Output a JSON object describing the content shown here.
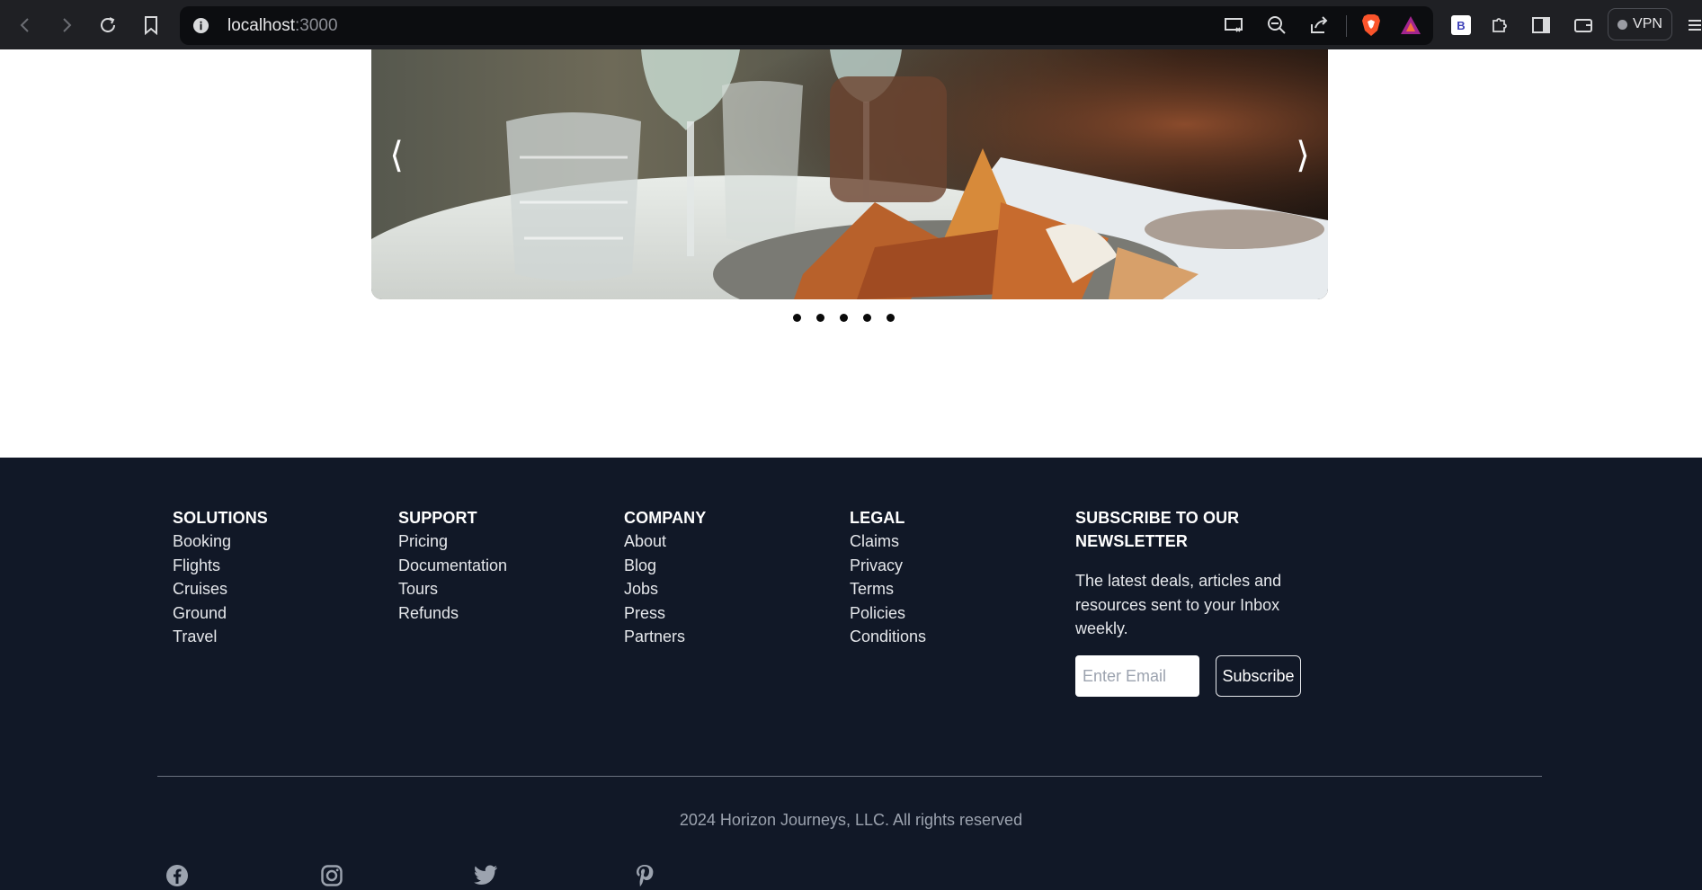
{
  "browser": {
    "url_host": "localhost",
    "url_port": ":3000",
    "vpn_label": "VPN",
    "bookmark_badge": "B"
  },
  "carousel": {
    "prev_glyph": "⟨",
    "next_glyph": "⟩",
    "slide_count": 5
  },
  "footer": {
    "columns": [
      {
        "title": "SOLUTIONS",
        "links": [
          "Booking",
          "Flights",
          "Cruises",
          "Ground",
          "Travel"
        ]
      },
      {
        "title": "SUPPORT",
        "links": [
          "Pricing",
          "Documentation",
          "Tours",
          "Refunds"
        ]
      },
      {
        "title": "COMPANY",
        "links": [
          "About",
          "Blog",
          "Jobs",
          "Press",
          "Partners"
        ]
      },
      {
        "title": "LEGAL",
        "links": [
          "Claims",
          "Privacy",
          "Terms",
          "Policies",
          "Conditions"
        ]
      }
    ],
    "newsletter": {
      "title": "SUBSCRIBE TO OUR NEWSLETTER",
      "description": "The latest deals, articles and resources sent to your Inbox weekly.",
      "email_placeholder": "Enter Email",
      "subscribe_label": "Subscribe"
    },
    "copyright": "2024 Horizon Journeys, LLC. All rights reserved",
    "social_icons": [
      "facebook-icon",
      "instagram-icon",
      "twitter-icon",
      "pinterest-icon"
    ]
  },
  "colors": {
    "chrome_bg": "#1f2024",
    "footer_bg": "#111827",
    "brave_orange": "#fb542b"
  }
}
